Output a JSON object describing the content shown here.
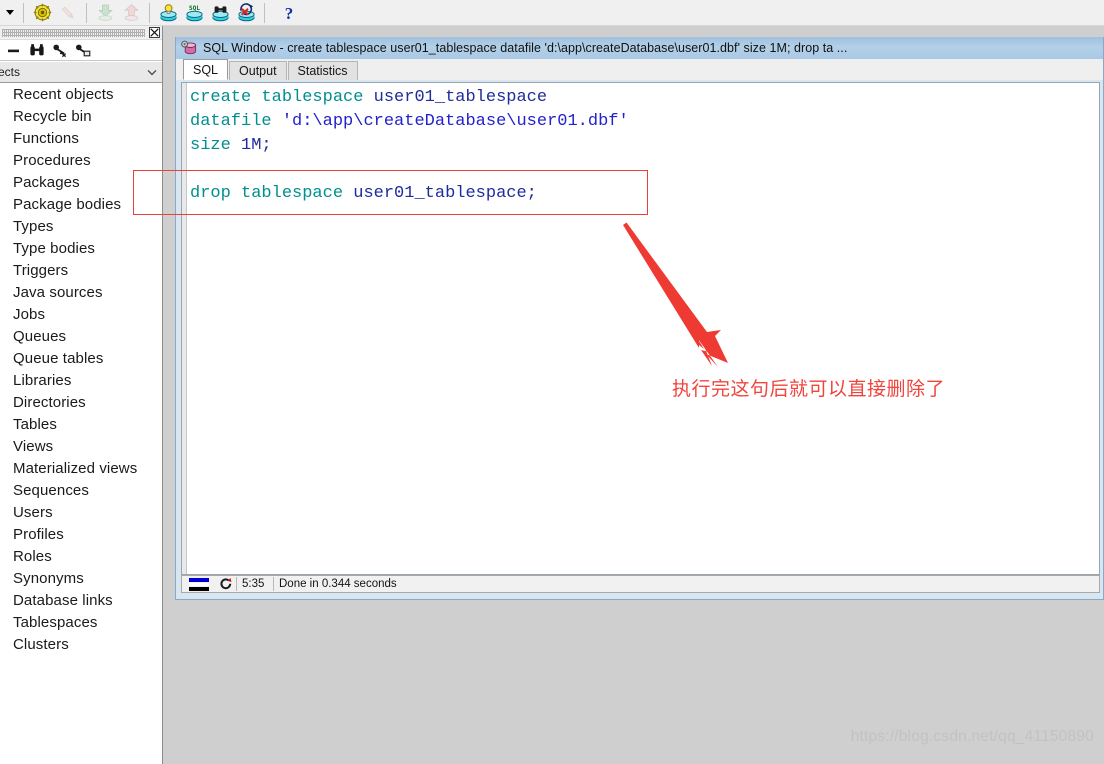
{
  "app": {
    "toolbar": {
      "dropdown_caret": "caret-down",
      "buttons": [
        {
          "name": "session-settings-icon",
          "glyph": "gear-yellow",
          "enabled": true
        },
        {
          "name": "pencil-edit-icon",
          "glyph": "pencil",
          "enabled": false
        },
        {
          "name": "import-download-icon",
          "glyph": "down-arrow-disc",
          "enabled": false
        },
        {
          "name": "export-upload-icon",
          "glyph": "up-arrow-disc",
          "enabled": false
        },
        {
          "name": "db-explain-plan-icon",
          "glyph": "db-bulb",
          "enabled": true
        },
        {
          "name": "db-sql-window-icon",
          "glyph": "db-sql",
          "enabled": true
        },
        {
          "name": "db-find-icon",
          "glyph": "db-binoculars",
          "enabled": true
        },
        {
          "name": "db-rollback-icon",
          "glyph": "db-rollback",
          "enabled": true
        },
        {
          "name": "help-icon",
          "glyph": "question-mark",
          "enabled": true
        }
      ]
    }
  },
  "sidebar": {
    "close_button": "close-window-icon",
    "tools": [
      {
        "name": "collapse-all-icon",
        "glyph": "minus"
      },
      {
        "name": "find-binoculars-icon",
        "glyph": "binoculars"
      },
      {
        "name": "filter-key-icon",
        "glyph": "key-wand"
      },
      {
        "name": "privileges-key-icon",
        "glyph": "key-lock"
      }
    ],
    "filter_dropdown": {
      "value": "ects",
      "caret": "chevron-down-icon"
    },
    "items": [
      {
        "label": "Recent objects",
        "icon": "folder-icon"
      },
      {
        "label": "Recycle bin",
        "icon": "folder-icon"
      },
      {
        "label": "Functions",
        "icon": "folder-icon"
      },
      {
        "label": "Procedures",
        "icon": "folder-icon"
      },
      {
        "label": "Packages",
        "icon": "folder-icon"
      },
      {
        "label": "Package bodies",
        "icon": "folder-icon"
      },
      {
        "label": "Types",
        "icon": "folder-icon"
      },
      {
        "label": "Type bodies",
        "icon": "folder-icon"
      },
      {
        "label": "Triggers",
        "icon": "folder-icon"
      },
      {
        "label": "Java sources",
        "icon": "folder-icon"
      },
      {
        "label": "Jobs",
        "icon": "folder-icon"
      },
      {
        "label": "Queues",
        "icon": "folder-icon"
      },
      {
        "label": "Queue tables",
        "icon": "folder-icon"
      },
      {
        "label": "Libraries",
        "icon": "folder-icon"
      },
      {
        "label": "Directories",
        "icon": "folder-icon"
      },
      {
        "label": "Tables",
        "icon": "folder-icon"
      },
      {
        "label": "Views",
        "icon": "folder-icon"
      },
      {
        "label": "Materialized views",
        "icon": "folder-icon"
      },
      {
        "label": "Sequences",
        "icon": "folder-icon"
      },
      {
        "label": "Users",
        "icon": "folder-icon"
      },
      {
        "label": "Profiles",
        "icon": "folder-icon"
      },
      {
        "label": "Roles",
        "icon": "folder-icon"
      },
      {
        "label": "Synonyms",
        "icon": "folder-icon"
      },
      {
        "label": "Database links",
        "icon": "folder-icon"
      },
      {
        "label": "Tablespaces",
        "icon": "folder-icon"
      },
      {
        "label": "Clusters",
        "icon": "folder-icon"
      }
    ]
  },
  "sql_window": {
    "title": "SQL Window - create tablespace user01_tablespace datafile 'd:\\app\\createDatabase\\user01.dbf' size 1M; drop ta ...",
    "title_icon": "database-cylinder-icon",
    "tabs": [
      {
        "label": "SQL",
        "active": true
      },
      {
        "label": "Output",
        "active": false
      },
      {
        "label": "Statistics",
        "active": false
      }
    ],
    "editor": {
      "lines": [
        [
          {
            "t": "create",
            "c": "kw"
          },
          {
            "t": " ",
            "c": "pun"
          },
          {
            "t": "tablespace",
            "c": "kw"
          },
          {
            "t": " ",
            "c": "pun"
          },
          {
            "t": "user01_tablespace",
            "c": "idn"
          }
        ],
        [
          {
            "t": "datafile",
            "c": "kw"
          },
          {
            "t": " ",
            "c": "pun"
          },
          {
            "t": "'d:\\app\\createDatabase\\user01.dbf'",
            "c": "str"
          }
        ],
        [
          {
            "t": "size",
            "c": "kw"
          },
          {
            "t": " ",
            "c": "pun"
          },
          {
            "t": "1M;",
            "c": "num"
          }
        ],
        [],
        [
          {
            "t": "drop",
            "c": "kw"
          },
          {
            "t": " ",
            "c": "pun"
          },
          {
            "t": "tablespace",
            "c": "kw"
          },
          {
            "t": " ",
            "c": "pun"
          },
          {
            "t": "user01_tablespace;",
            "c": "idn"
          }
        ]
      ]
    },
    "status_bar": {
      "progress_icon": "progress-bars-icon",
      "refresh_icon": "refresh-rollback-icon",
      "time": "5:35",
      "message": "Done in 0.344 seconds"
    }
  },
  "annotations": {
    "highlight_box": {
      "name": "red-highlight-rectangle",
      "color": "#e8413a"
    },
    "arrow": {
      "name": "red-arrow",
      "color": "#ee3a33"
    },
    "note_text": "执行完这句后就可以直接删除了",
    "note_color": "#f0443c"
  },
  "watermark": {
    "text": "https://blog.csdn.net/qq_41150890"
  }
}
